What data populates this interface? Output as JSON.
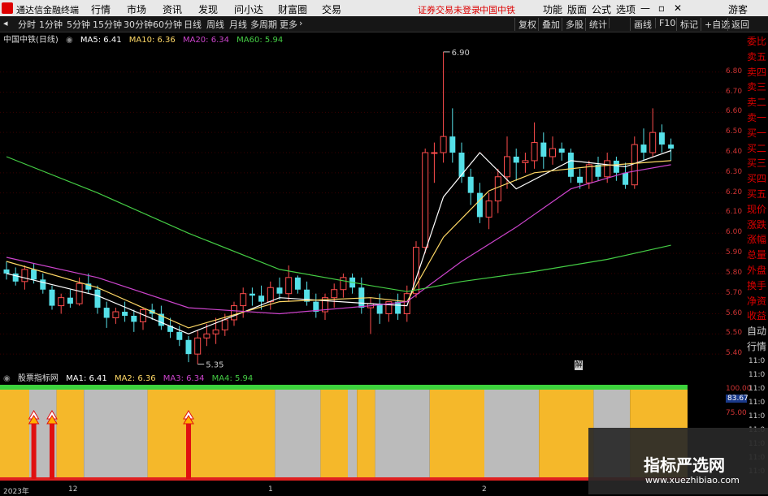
{
  "titlebar": {
    "app_title": "通达信金融终端",
    "menu": [
      "行情",
      "市场",
      "资讯",
      "发现",
      "问小达",
      "财富圈",
      "交易"
    ],
    "status_text": "证券交易未登录",
    "stock_name": "中国中铁",
    "right_menu": [
      "功能",
      "版面",
      "公式",
      "选项",
      "游客"
    ]
  },
  "toolbar": {
    "periods": [
      "分时",
      "1分钟",
      "5分钟",
      "15分钟",
      "30分钟",
      "60分钟",
      "日线",
      "周线",
      "月线",
      "多周期",
      "更多"
    ],
    "right_buttons": [
      "复权",
      "叠加",
      "多股",
      "统计",
      "画线",
      "F10",
      "标记",
      "+自选",
      "返回"
    ]
  },
  "main_info": {
    "stock_label": "中国中铁(日线)",
    "ma5": "MA5: 6.41",
    "ma10": "MA10: 6.36",
    "ma20": "MA20: 6.34",
    "ma60": "MA60: 5.94"
  },
  "price_axis": [
    "6.80",
    "6.70",
    "6.60",
    "6.50",
    "6.40",
    "6.30",
    "6.20",
    "6.10",
    "6.00",
    "5.90",
    "5.80",
    "5.70",
    "5.60",
    "5.50",
    "5.40"
  ],
  "indicator_axis": [
    "100.00",
    "83.67",
    "75.00"
  ],
  "annotations": {
    "high": "6.90",
    "low": "5.35"
  },
  "right_panel": [
    "委比",
    "卖五",
    "卖四",
    "卖三",
    "卖二",
    "卖一",
    "买一",
    "买二",
    "买三",
    "买四",
    "买五",
    "现价",
    "涨跌",
    "涨幅",
    "总量",
    "外盘",
    "换手",
    "净资",
    "收益",
    "自动",
    "行情"
  ],
  "time_axis": [
    "11:0",
    "11:0",
    "11:0",
    "11:0",
    "11:0",
    "11:0",
    "11:0",
    "11:0",
    "11:0"
  ],
  "indicator_info": {
    "label": "股票指标网",
    "ma1": "MA1: 6.41",
    "ma2": "MA2: 6.36",
    "ma3": "MA3: 6.34",
    "ma4": "MA4: 5.94"
  },
  "date_axis": {
    "year": "2023年",
    "m12": "12",
    "m1": "1",
    "m2": "2"
  },
  "watermark": {
    "title": "指标严选网",
    "url": "www.xuezhibiao.com"
  },
  "colors": {
    "up": "#ff4d4d",
    "down": "#55e0e8",
    "ma5": "#ffffff",
    "ma10": "#ffd966",
    "ma20": "#cc44cc",
    "ma60": "#44cc44",
    "band_yellow": "#f5b82a",
    "band_gray": "#bbbbbb"
  },
  "chart_data": {
    "type": "candlestick",
    "candles": [
      [
        5.82,
        5.86,
        5.77,
        5.8
      ],
      [
        5.8,
        5.83,
        5.74,
        5.76
      ],
      [
        5.76,
        5.84,
        5.72,
        5.82
      ],
      [
        5.82,
        5.85,
        5.75,
        5.77
      ],
      [
        5.77,
        5.8,
        5.7,
        5.72
      ],
      [
        5.72,
        5.74,
        5.62,
        5.64
      ],
      [
        5.64,
        5.7,
        5.6,
        5.68
      ],
      [
        5.68,
        5.72,
        5.63,
        5.65
      ],
      [
        5.65,
        5.78,
        5.64,
        5.75
      ],
      [
        5.75,
        5.8,
        5.7,
        5.72
      ],
      [
        5.72,
        5.74,
        5.6,
        5.63
      ],
      [
        5.63,
        5.66,
        5.53,
        5.58
      ],
      [
        5.58,
        5.63,
        5.55,
        5.61
      ],
      [
        5.61,
        5.66,
        5.56,
        5.59
      ],
      [
        5.59,
        5.62,
        5.51,
        5.56
      ],
      [
        5.56,
        5.63,
        5.52,
        5.62
      ],
      [
        5.62,
        5.65,
        5.57,
        5.6
      ],
      [
        5.6,
        5.64,
        5.52,
        5.54
      ],
      [
        5.54,
        5.58,
        5.48,
        5.51
      ],
      [
        5.51,
        5.54,
        5.44,
        5.47
      ],
      [
        5.47,
        5.49,
        5.36,
        5.4
      ],
      [
        5.4,
        5.52,
        5.35,
        5.48
      ],
      [
        5.48,
        5.55,
        5.44,
        5.5
      ],
      [
        5.5,
        5.58,
        5.45,
        5.52
      ],
      [
        5.52,
        5.6,
        5.49,
        5.57
      ],
      [
        5.57,
        5.66,
        5.54,
        5.64
      ],
      [
        5.64,
        5.73,
        5.58,
        5.7
      ],
      [
        5.7,
        5.73,
        5.64,
        5.69
      ],
      [
        5.69,
        5.74,
        5.62,
        5.66
      ],
      [
        5.66,
        5.76,
        5.62,
        5.73
      ],
      [
        5.73,
        5.78,
        5.67,
        5.7
      ],
      [
        5.7,
        5.84,
        5.66,
        5.78
      ],
      [
        5.78,
        5.79,
        5.7,
        5.72
      ],
      [
        5.72,
        5.76,
        5.64,
        5.66
      ],
      [
        5.66,
        5.7,
        5.58,
        5.61
      ],
      [
        5.61,
        5.7,
        5.57,
        5.68
      ],
      [
        5.68,
        5.75,
        5.63,
        5.72
      ],
      [
        5.72,
        5.8,
        5.68,
        5.78
      ],
      [
        5.78,
        5.8,
        5.7,
        5.73
      ],
      [
        5.73,
        5.78,
        5.6,
        5.63
      ],
      [
        5.63,
        5.68,
        5.5,
        5.65
      ],
      [
        5.65,
        5.7,
        5.55,
        5.6
      ],
      [
        5.6,
        5.66,
        5.56,
        5.66
      ],
      [
        5.66,
        5.7,
        5.57,
        5.6
      ],
      [
        5.6,
        5.74,
        5.56,
        5.7
      ],
      [
        5.7,
        5.96,
        5.68,
        5.93
      ],
      [
        5.93,
        6.42,
        5.9,
        6.4
      ],
      [
        6.4,
        6.45,
        6.25,
        6.4
      ],
      [
        6.4,
        6.9,
        6.35,
        6.48
      ],
      [
        6.48,
        6.62,
        6.35,
        6.4
      ],
      [
        6.4,
        6.45,
        6.25,
        6.28
      ],
      [
        6.28,
        6.32,
        6.14,
        6.2
      ],
      [
        6.2,
        6.25,
        6.05,
        6.08
      ],
      [
        6.08,
        6.2,
        6.02,
        6.16
      ],
      [
        6.16,
        6.32,
        6.1,
        6.28
      ],
      [
        6.28,
        6.48,
        6.22,
        6.38
      ],
      [
        6.38,
        6.42,
        6.26,
        6.35
      ],
      [
        6.35,
        6.4,
        6.3,
        6.36
      ],
      [
        6.36,
        6.55,
        6.32,
        6.45
      ],
      [
        6.45,
        6.5,
        6.32,
        6.38
      ],
      [
        6.38,
        6.48,
        6.34,
        6.42
      ],
      [
        6.42,
        6.45,
        6.36,
        6.4
      ],
      [
        6.4,
        6.42,
        6.25,
        6.28
      ],
      [
        6.28,
        6.32,
        6.22,
        6.25
      ],
      [
        6.25,
        6.36,
        6.22,
        6.34
      ],
      [
        6.34,
        6.38,
        6.26,
        6.28
      ],
      [
        6.28,
        6.4,
        6.25,
        6.36
      ],
      [
        6.36,
        6.38,
        6.26,
        6.3
      ],
      [
        6.3,
        6.35,
        6.22,
        6.24
      ],
      [
        6.24,
        6.48,
        6.22,
        6.44
      ],
      [
        6.44,
        6.52,
        6.36,
        6.4
      ],
      [
        6.4,
        6.62,
        6.38,
        6.5
      ],
      [
        6.5,
        6.54,
        6.4,
        6.44
      ],
      [
        6.44,
        6.47,
        6.36,
        6.42
      ]
    ],
    "ma": {
      "ma5": [
        [
          0,
          5.8
        ],
        [
          10,
          5.69
        ],
        [
          20,
          5.5
        ],
        [
          30,
          5.68
        ],
        [
          40,
          5.65
        ],
        [
          44,
          5.64
        ],
        [
          48,
          6.18
        ],
        [
          52,
          6.4
        ],
        [
          56,
          6.22
        ],
        [
          62,
          6.36
        ],
        [
          68,
          6.33
        ],
        [
          73,
          6.41
        ]
      ],
      "ma10": [
        [
          0,
          5.86
        ],
        [
          10,
          5.73
        ],
        [
          20,
          5.53
        ],
        [
          30,
          5.66
        ],
        [
          40,
          5.68
        ],
        [
          44,
          5.66
        ],
        [
          48,
          5.98
        ],
        [
          53,
          6.21
        ],
        [
          58,
          6.3
        ],
        [
          64,
          6.33
        ],
        [
          73,
          6.36
        ]
      ],
      "ma20": [
        [
          0,
          5.88
        ],
        [
          10,
          5.78
        ],
        [
          20,
          5.63
        ],
        [
          30,
          5.6
        ],
        [
          40,
          5.64
        ],
        [
          44,
          5.66
        ],
        [
          50,
          5.86
        ],
        [
          56,
          6.03
        ],
        [
          62,
          6.22
        ],
        [
          68,
          6.3
        ],
        [
          73,
          6.34
        ]
      ],
      "ma60": [
        [
          0,
          6.38
        ],
        [
          10,
          6.2
        ],
        [
          20,
          6.0
        ],
        [
          30,
          5.82
        ],
        [
          40,
          5.74
        ],
        [
          44,
          5.71
        ],
        [
          50,
          5.76
        ],
        [
          58,
          5.81
        ],
        [
          66,
          5.87
        ],
        [
          73,
          5.94
        ]
      ]
    },
    "ylim": [
      5.32,
      6.94
    ],
    "indicator": {
      "bands": [
        [
          "y",
          0,
          3
        ],
        [
          "g",
          3,
          6
        ],
        [
          "y",
          6,
          9
        ],
        [
          "g",
          9,
          16
        ],
        [
          "y",
          16,
          30
        ],
        [
          "g",
          30,
          35
        ],
        [
          "y",
          35,
          38
        ],
        [
          "g",
          38,
          39
        ],
        [
          "y",
          39,
          41
        ],
        [
          "g",
          41,
          47
        ],
        [
          "y",
          47,
          53
        ],
        [
          "g",
          53,
          59
        ],
        [
          "y",
          59,
          65
        ],
        [
          "g",
          65,
          69
        ],
        [
          "y",
          69,
          74
        ]
      ],
      "signals": [
        3,
        5,
        20
      ]
    }
  }
}
